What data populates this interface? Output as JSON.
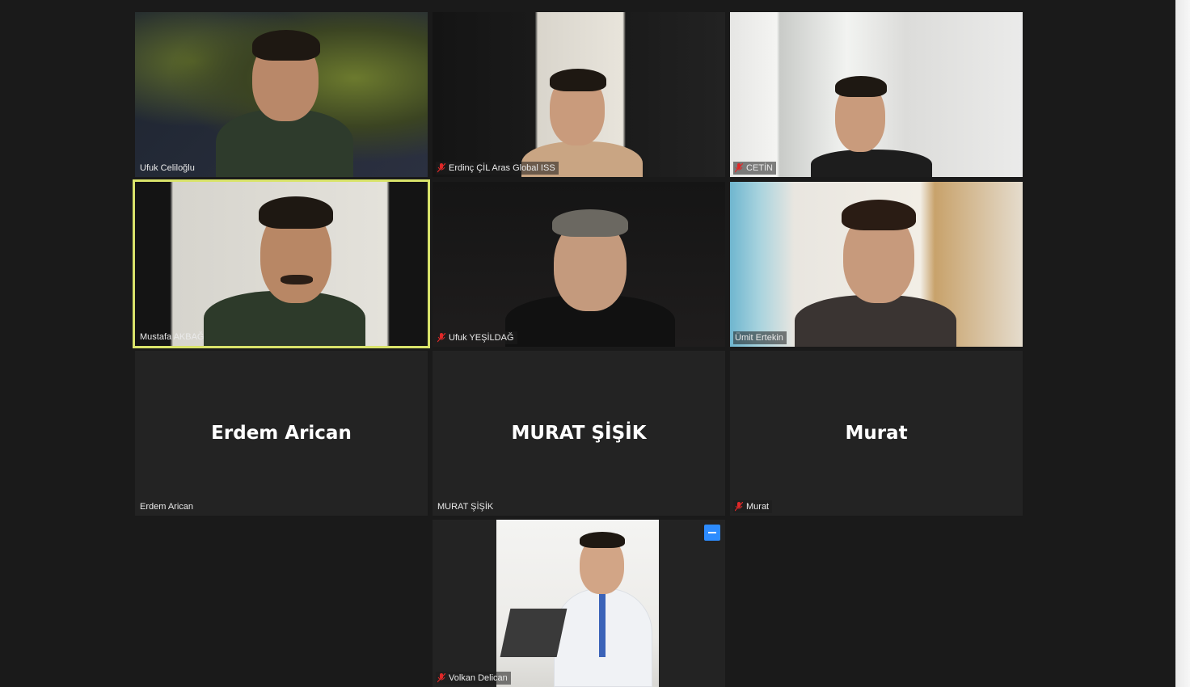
{
  "meeting": {
    "participants": [
      {
        "name": "Ufuk Celiloğlu",
        "muted": false,
        "video": true
      },
      {
        "name": "Erdinç ÇİL Aras Global ISS",
        "muted": true,
        "video": true
      },
      {
        "name": "CETİN",
        "muted": true,
        "video": true
      },
      {
        "name": "Mustafa AKBAĞ",
        "muted": false,
        "video": true,
        "active_speaker": true
      },
      {
        "name": "Ufuk YEŞİLDAĞ",
        "muted": true,
        "video": true
      },
      {
        "name": "Ümit Ertekin",
        "muted": false,
        "video": true
      },
      {
        "name": "Erdem Arican",
        "display_name": "Erdem Arican",
        "muted": false,
        "video": false
      },
      {
        "name": "MURAT ŞİŞİK",
        "display_name": "MURAT ŞİŞİK",
        "muted": false,
        "video": false
      },
      {
        "name": "Murat",
        "display_name": "Murat",
        "muted": true,
        "video": false
      },
      {
        "name": "Volkan Delican",
        "muted": true,
        "video": true
      }
    ]
  },
  "icons": {
    "mute": "microphone-muted-icon",
    "more": "more-options-icon"
  },
  "colors": {
    "background": "#1a1a1a",
    "tile": "#232323",
    "active_border": "#d9e36a",
    "muted_red": "#e02828",
    "more_button": "#2d8cff"
  }
}
